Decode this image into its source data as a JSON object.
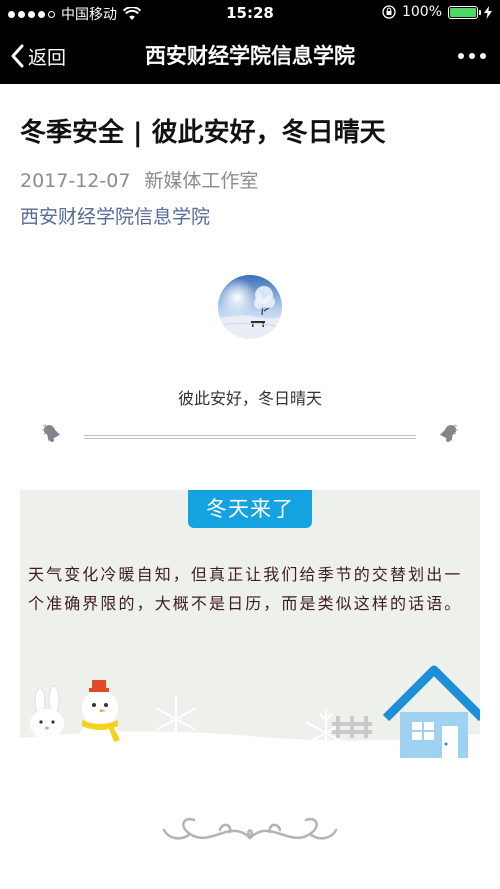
{
  "status_bar": {
    "carrier": "中国移动",
    "time": "15:28",
    "battery": "100%",
    "battery_level": 1.0
  },
  "nav": {
    "back_label": "返回",
    "title": "西安财经学院信息学院"
  },
  "article": {
    "title": "冬季安全 | 彼此安好，冬日晴天",
    "date": "2017-12-07",
    "author": "新媒体工作室",
    "account": "西安财经学院信息学院",
    "subtitle": "彼此安好，冬日晴天",
    "section_tag": "冬天来了",
    "paragraph": "天气变化冷暖自知，但真正让我们给季节的交替划出一个准确界限的，大概不是日历，而是类似这样的话语。"
  },
  "colors": {
    "bar_bg": "#000000",
    "link": "#576b95",
    "tag_bg": "#14a3e0",
    "card_bg": "#eef0ec",
    "battery": "#4cd964"
  }
}
